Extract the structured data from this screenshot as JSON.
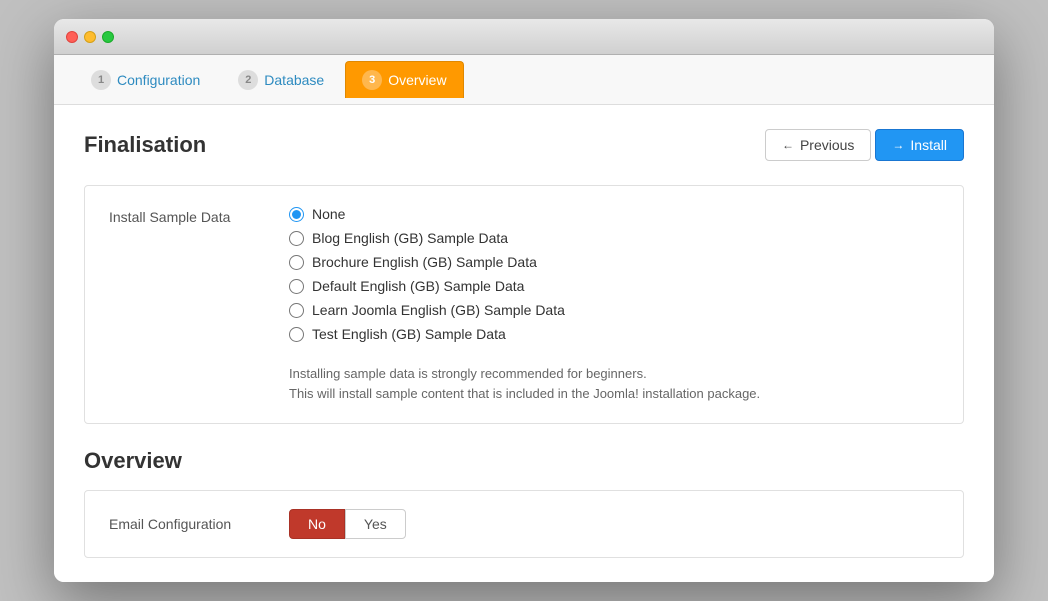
{
  "window": {
    "traffic_lights": {
      "red": "close",
      "yellow": "minimize",
      "green": "maximize"
    }
  },
  "tabs": [
    {
      "id": "configuration",
      "number": "1",
      "label": "Configuration",
      "active": false
    },
    {
      "id": "database",
      "number": "2",
      "label": "Database",
      "active": false
    },
    {
      "id": "overview",
      "number": "3",
      "label": "Overview",
      "active": true
    }
  ],
  "finalisation": {
    "title": "Finalisation",
    "buttons": {
      "previous_label": "Previous",
      "install_label": "Install"
    },
    "install_sample_data": {
      "label": "Install Sample Data",
      "options": [
        {
          "id": "none",
          "label": "None",
          "checked": true
        },
        {
          "id": "blog_english",
          "label": "Blog English (GB) Sample Data",
          "checked": false
        },
        {
          "id": "brochure_english",
          "label": "Brochure English (GB) Sample Data",
          "checked": false
        },
        {
          "id": "default_english",
          "label": "Default English (GB) Sample Data",
          "checked": false
        },
        {
          "id": "learn_joomla",
          "label": "Learn Joomla English (GB) Sample Data",
          "checked": false
        },
        {
          "id": "test_english",
          "label": "Test English (GB) Sample Data",
          "checked": false
        }
      ],
      "help_line1": "Installing sample data is strongly recommended for beginners.",
      "help_line2": "This will install sample content that is included in the Joomla! installation package."
    }
  },
  "overview": {
    "title": "Overview",
    "email_configuration": {
      "label": "Email Configuration",
      "no_label": "No",
      "yes_label": "Yes",
      "current": "No"
    }
  }
}
